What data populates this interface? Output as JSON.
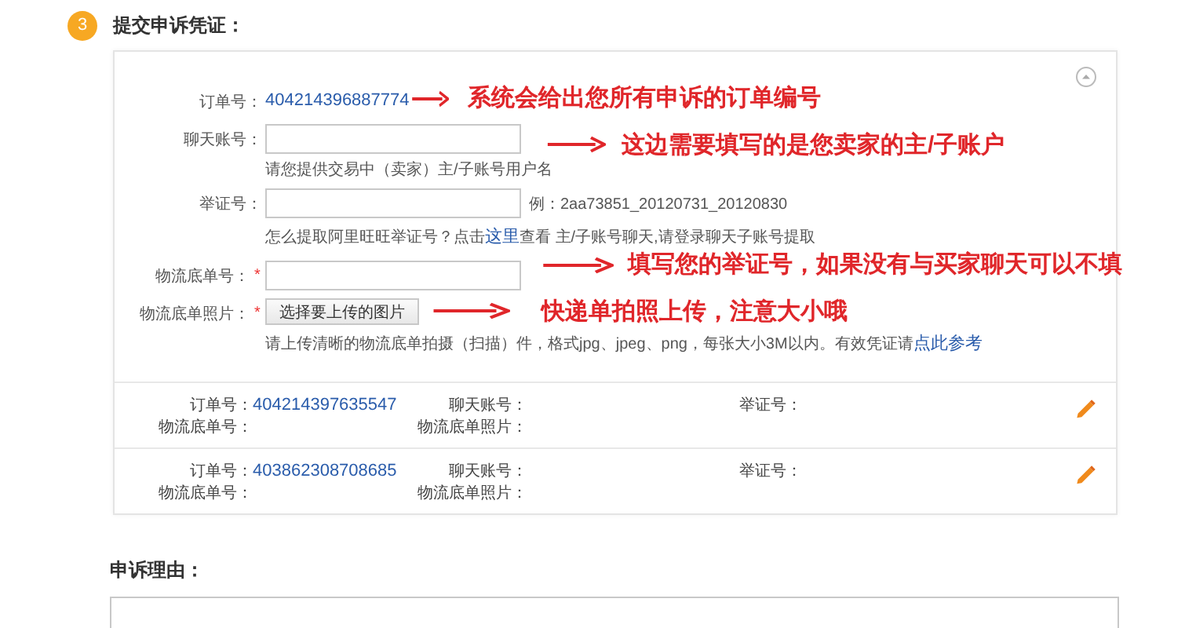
{
  "step": {
    "number": "3",
    "title": "提交申诉凭证："
  },
  "form": [
    {
      "kind": "link",
      "label": "订单号：",
      "value": "404214396887774"
    },
    {
      "kind": "input",
      "label": "聊天账号：",
      "hint": "请您提供交易中（卖家）主/子账号用户名"
    },
    {
      "kind": "input",
      "label": "举证号：",
      "example": "例：2aa73851_20120731_20120830",
      "hint": "怎么提取阿里旺旺举证号？点击",
      "hint_link": "这里",
      "hint_after": "查看 主/子账号聊天,请登录聊天子账号提取"
    },
    {
      "kind": "input",
      "label": "物流底单号：",
      "required_mark": "*"
    },
    {
      "kind": "button",
      "label": "物流底单照片：",
      "required_mark": "*",
      "button": "选择要上传的图片",
      "hint": "请上传清晰的物流底单拍摄（扫描）件，格式jpg、jpeg、png，每张大小3M以内。有效凭证请",
      "hint_link": "点此参考"
    }
  ],
  "records": [
    {
      "fields": [
        {
          "label": "订单号：",
          "value": "404214397635547"
        },
        {
          "label": "聊天账号："
        },
        {
          "label": "举证号："
        },
        {
          "label": "物流底单号："
        },
        {
          "label": "物流底单照片："
        }
      ]
    },
    {
      "fields": [
        {
          "label": "订单号：",
          "value": "403862308708685"
        },
        {
          "label": "聊天账号："
        },
        {
          "label": "举证号："
        },
        {
          "label": "物流底单号："
        },
        {
          "label": "物流底单照片："
        }
      ]
    }
  ],
  "annotations": [
    "系统会给出您所有申诉的订单编号",
    "这边需要填写的是您卖家的主/子账户",
    "填写您的举证号，如果没有与买家聊天可以不填",
    "快递单拍照上传，注意大小哦"
  ],
  "reason": {
    "title": "申诉理由："
  }
}
